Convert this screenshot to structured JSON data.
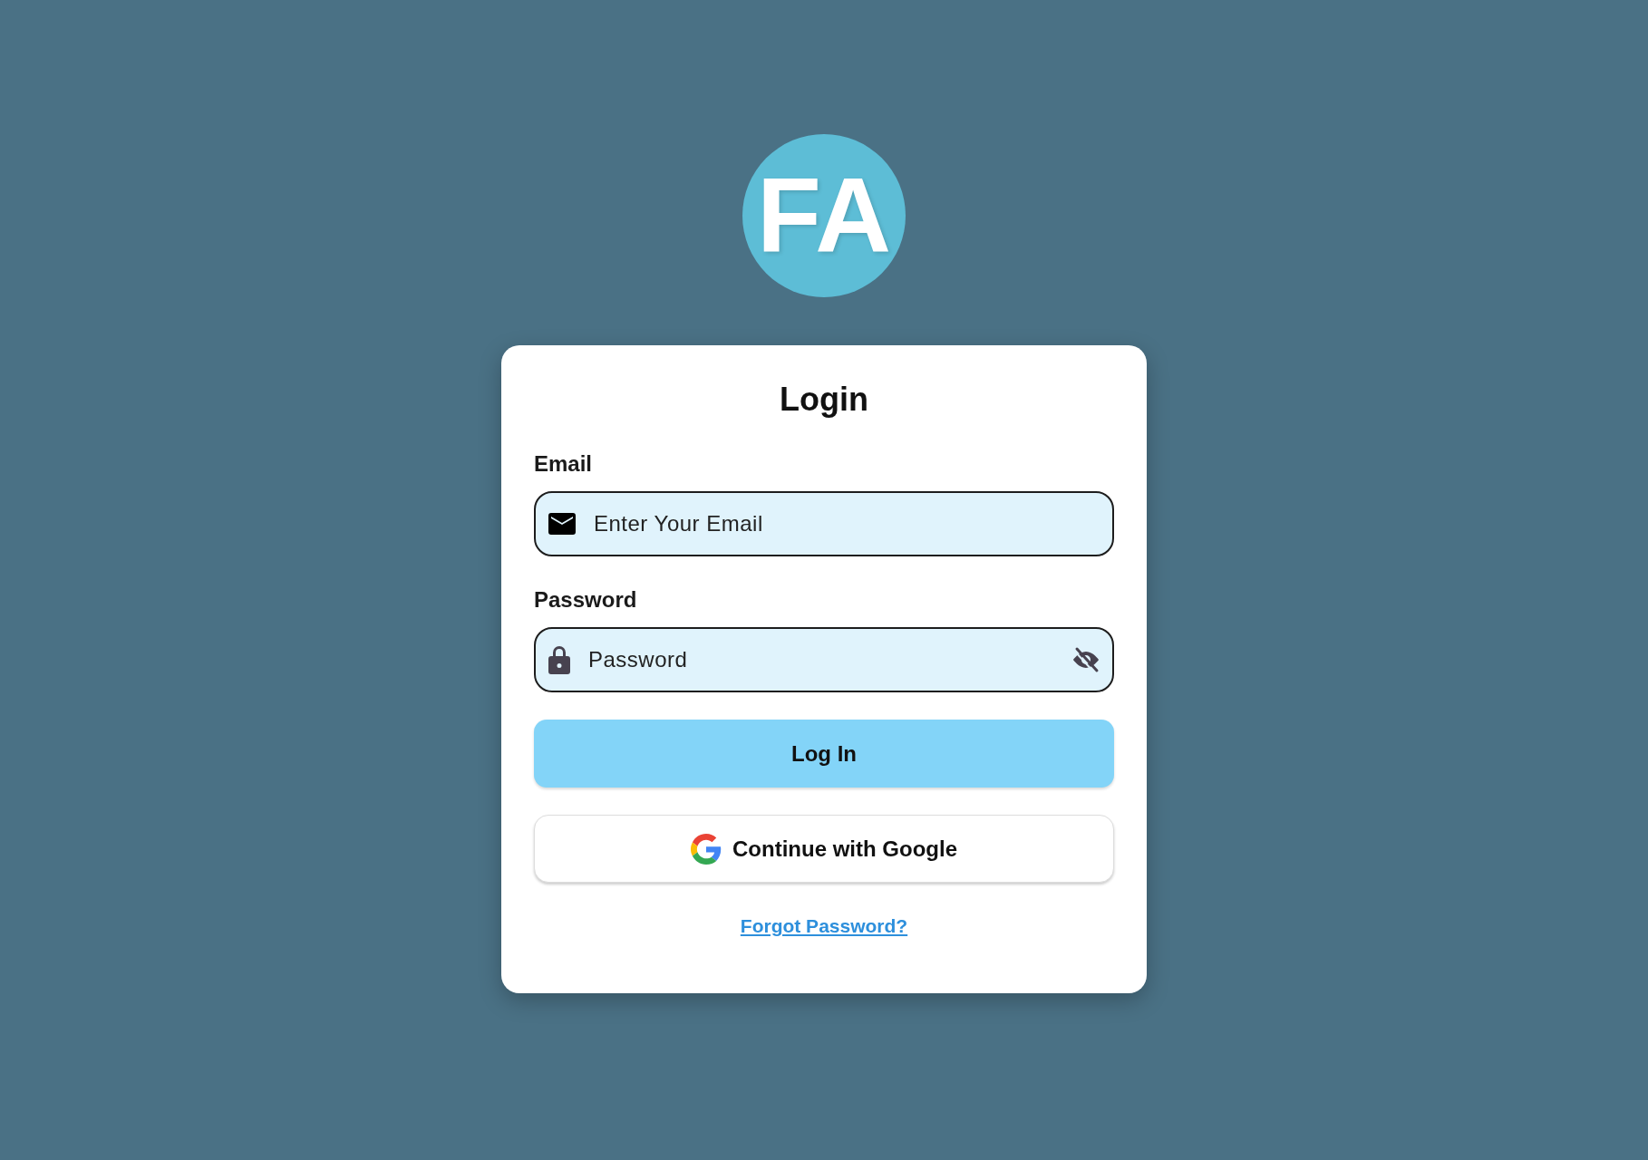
{
  "logo": {
    "text": "FA"
  },
  "title": "Login",
  "fields": [
    {
      "label": "Email",
      "placeholder": "Enter Your Email",
      "kind": "email"
    },
    {
      "label": "Password",
      "placeholder": "Password",
      "kind": "password"
    }
  ],
  "login_button": "Log In",
  "google_button": "Continue with Google",
  "forgot_link": "Forgot Password?"
}
